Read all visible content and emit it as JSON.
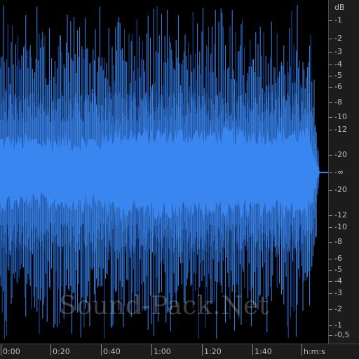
{
  "colors": {
    "background": "#000000",
    "waveform": "#3a86f0",
    "waveform_dark": "#1d4fa8",
    "ruler_bg": "#1c1c1c",
    "ruler_text": "#bdbdbd"
  },
  "db_scale": {
    "unit": "dB",
    "upper": [
      "-1",
      "-2",
      "-3",
      "-4",
      "-5",
      "-6",
      "-8",
      "-10",
      "-12",
      "-20"
    ],
    "center": "-∞",
    "lower": [
      "-20",
      "-12",
      "-10",
      "-8",
      "-6",
      "-5",
      "-4",
      "-3",
      "-2",
      "-1",
      "-0,5"
    ]
  },
  "time_scale": {
    "labels": [
      "0:00",
      "0:20",
      "0:40",
      "1:00",
      "1:20",
      "1:40"
    ],
    "unit": "h:m:s"
  },
  "watermark": "Sound-Pack.Net"
}
